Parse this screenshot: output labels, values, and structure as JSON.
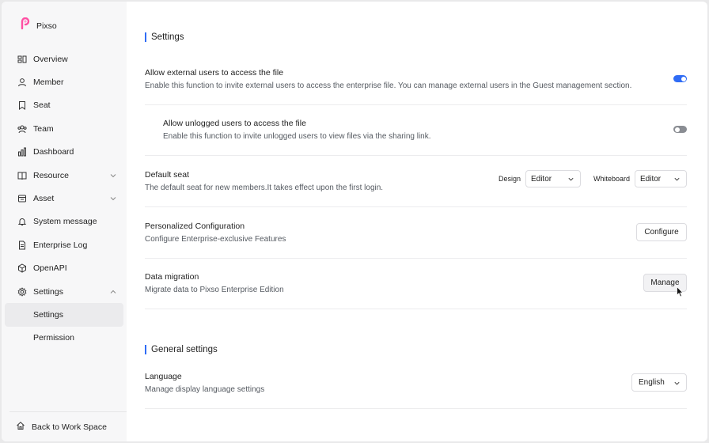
{
  "app": {
    "name": "Pixso"
  },
  "sidebar": {
    "items": [
      {
        "label": "Overview",
        "icon": "overview-icon"
      },
      {
        "label": "Member",
        "icon": "user-icon"
      },
      {
        "label": "Seat",
        "icon": "bookmark-icon"
      },
      {
        "label": "Team",
        "icon": "team-icon"
      },
      {
        "label": "Dashboard",
        "icon": "bar-chart-icon"
      },
      {
        "label": "Resource",
        "icon": "book-icon",
        "expandable": true
      },
      {
        "label": "Asset",
        "icon": "asset-icon",
        "expandable": true
      },
      {
        "label": "System message",
        "icon": "bell-icon"
      },
      {
        "label": "Enterprise Log",
        "icon": "document-icon"
      },
      {
        "label": "OpenAPI",
        "icon": "cube-icon"
      },
      {
        "label": "Settings",
        "icon": "gear-icon",
        "expanded": true
      }
    ],
    "subitems": [
      {
        "label": "Settings",
        "active": true
      },
      {
        "label": "Permission",
        "active": false
      }
    ],
    "back_label": "Back to Work Space"
  },
  "settings": {
    "title": "Settings",
    "external": {
      "title": "Allow external users to access the file",
      "desc": "Enable this function to invite external users to access the enterprise file. You can manage external users in the Guest management section.",
      "enabled": true
    },
    "unlogged": {
      "title": "Allow unlogged users to access the file",
      "desc": "Enable this function to invite unlogged users to view files via the sharing link.",
      "enabled": false
    },
    "default_seat": {
      "title": "Default seat",
      "desc": "The default seat for new members.It takes effect upon the first login.",
      "design_label": "Design",
      "design_value": "Editor",
      "whiteboard_label": "Whiteboard",
      "whiteboard_value": "Editor"
    },
    "personalized": {
      "title": "Personalized Configuration",
      "desc": "Configure Enterprise-exclusive Features",
      "button": "Configure"
    },
    "migration": {
      "title": "Data migration",
      "desc": "Migrate data to Pixso Enterprise Edition",
      "button": "Manage"
    }
  },
  "general": {
    "title": "General settings",
    "language": {
      "title": "Language",
      "desc": "Manage display language settings",
      "value": "English"
    }
  },
  "colors": {
    "accent": "#2f6cf5",
    "sidebar_bg": "#f7f7f8",
    "logo": "#ff4fa3"
  }
}
